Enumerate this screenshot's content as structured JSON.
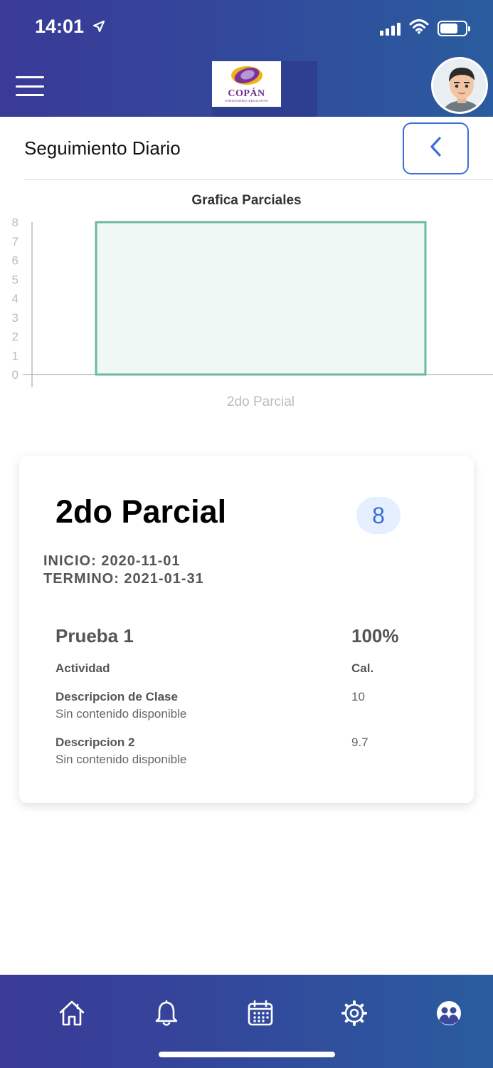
{
  "status_bar": {
    "time": "14:01"
  },
  "header": {
    "logo": {
      "word": "COPÁN",
      "tagline": "VANGUARDIA EDUCATIVA"
    }
  },
  "page": {
    "title": "Seguimiento Diario"
  },
  "chart_data": {
    "type": "bar",
    "title": "Grafica Parciales",
    "categories": [
      "2do Parcial"
    ],
    "values": [
      8
    ],
    "ylim": [
      0,
      8
    ],
    "yticks": [
      "0",
      "1",
      "2",
      "3",
      "4",
      "5",
      "6",
      "7",
      "8"
    ],
    "xlabel": "",
    "ylabel": "",
    "grid": false,
    "colors": {
      "bar_fill": "#f0f8f6",
      "bar_stroke": "#6cb9a1",
      "axis": "#bbbbbb",
      "tick_text": "#bbbbbb"
    }
  },
  "card": {
    "title": "2do Parcial",
    "grade": "8",
    "inicio": "INICIO: 2020-11-01",
    "termino": "TERMINO: 2021-01-31",
    "test_name": "Prueba 1",
    "test_weight": "100%",
    "col_activity": "Actividad",
    "col_grade": "Cal.",
    "rows": [
      {
        "title": "Descripcion de Clase",
        "subtitle": "Sin contenido disponible",
        "value": "10"
      },
      {
        "title": "Descripcion 2",
        "subtitle": "Sin contenido disponible",
        "value": "9.7"
      }
    ]
  },
  "nav": {
    "items": [
      "home-icon",
      "bell-icon",
      "calendar-icon",
      "settings-icon",
      "users-icon"
    ]
  },
  "colors": {
    "header_start": "#3a3a97",
    "header_end": "#2a5c9f",
    "accent": "#3a6fd8",
    "badge_bg": "#e6efff"
  }
}
